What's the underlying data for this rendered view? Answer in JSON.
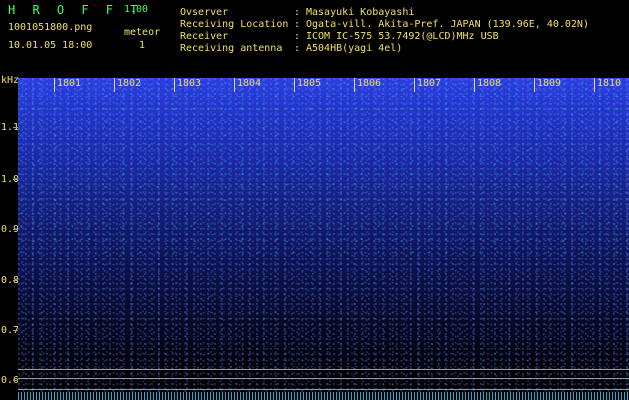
{
  "app": {
    "logo": "H R O F F T",
    "version": "1.00"
  },
  "capture": {
    "file": "1001051800.png",
    "datetime": "10.01.05 18:00",
    "meteor_label": "meteor",
    "meteor_count": "1"
  },
  "info": [
    {
      "key": "Ovserver",
      "sep": ":",
      "value": "Masayuki Kobayashi"
    },
    {
      "key": "Receiving Location",
      "sep": ":",
      "value": "Ogata-vill. Akita-Pref. JAPAN (139.96E, 40.02N)"
    },
    {
      "key": "Receiver",
      "sep": ":",
      "value": "ICOM IC-575 53.7492(@LCD)MHz USB"
    },
    {
      "key": "Receiving antenna",
      "sep": ":",
      "value": "A504HB(yagi 4el)"
    }
  ],
  "axis": {
    "unit": "kHz",
    "y_labels": [
      "1.1",
      "1.0",
      "0.9",
      "0.8",
      "0.7",
      "0.6"
    ],
    "time_labels": [
      "1801",
      "1802",
      "1803",
      "1804",
      "1805",
      "1806",
      "1807",
      "1808",
      "1809",
      "1810"
    ]
  },
  "colors": {
    "label": "#f0e060",
    "logo": "#33ff66",
    "spectrum_top": "#2b3fe0",
    "background": "#000000"
  }
}
